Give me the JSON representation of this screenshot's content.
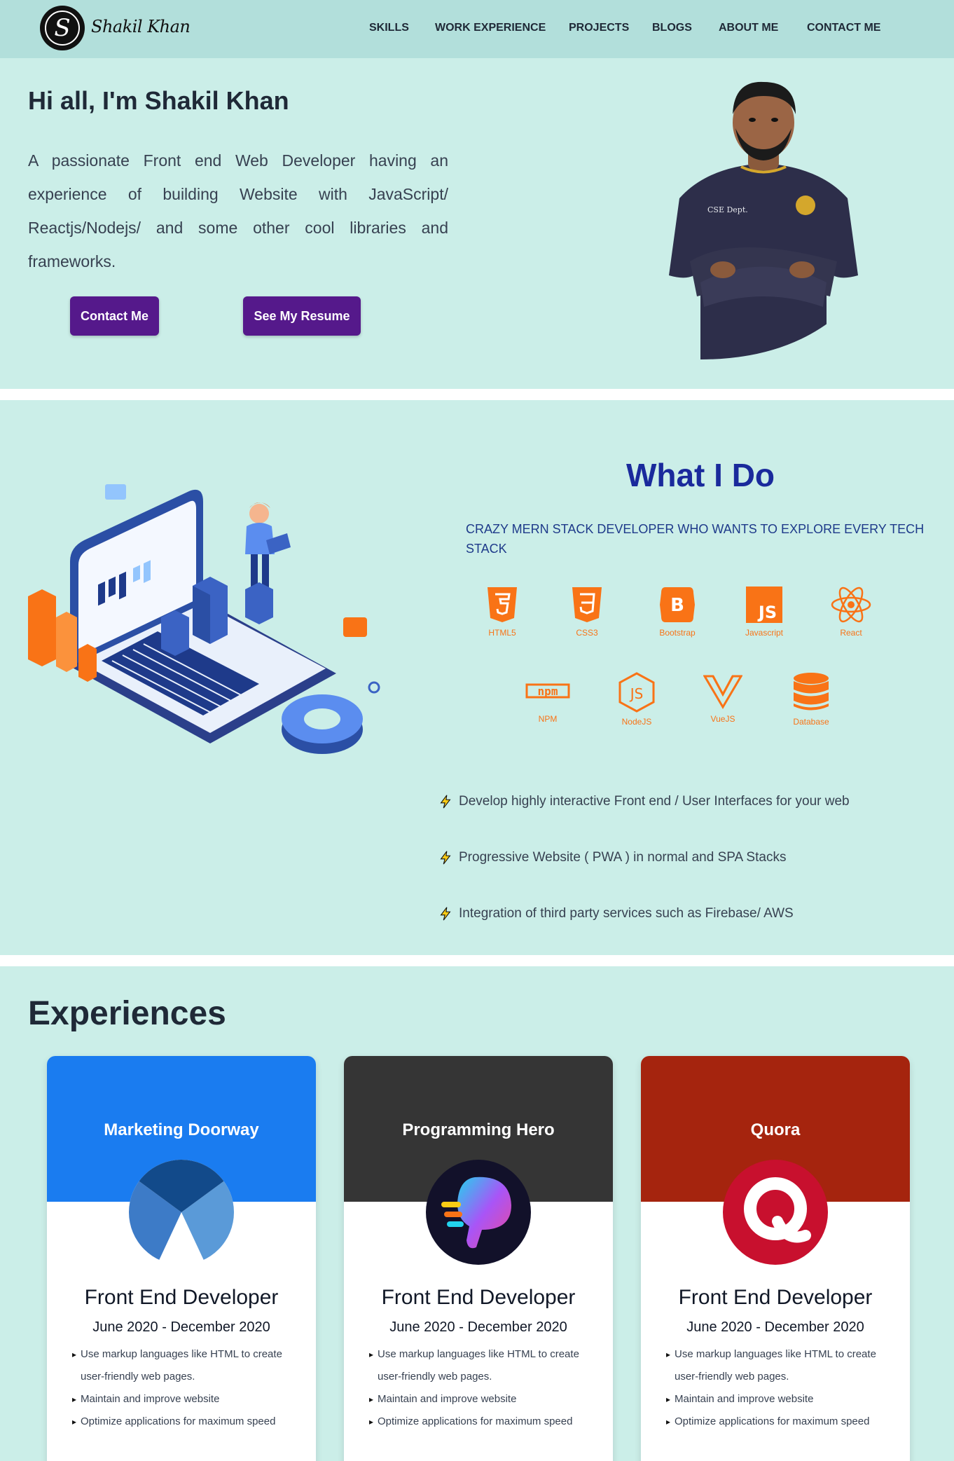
{
  "navbar": {
    "brand_letter": "S",
    "brand_name": "Shakil Khan",
    "links": [
      "SKILLS",
      "WORK EXPERIENCE",
      "PROJECTS",
      "BLOGS",
      "ABOUT ME",
      "CONTACT ME"
    ]
  },
  "hero": {
    "title": "Hi all, I'm Shakil Khan",
    "description": "A passionate Front end Web Developer having an experience of building Website with JavaScript/ Reactjs/Nodejs/ and some other cool libraries and frameworks.",
    "contact_button": "Contact Me",
    "resume_button": "See My Resume"
  },
  "whatido": {
    "title": "What I Do",
    "subtitle": "CRAZY MERN STACK DEVELOPER WHO WANTS TO EXPLORE EVERY TECH STACK",
    "skills": [
      "HTML5",
      "CSS3",
      "Bootstrap",
      "Javascript",
      "React",
      "NPM",
      "NodeJS",
      "VueJS",
      "Database"
    ],
    "points": [
      "Develop highly interactive Front end / User Interfaces for your web",
      "Progressive Website ( PWA ) in normal and SPA Stacks",
      "Integration of third party services such as Firebase/ AWS"
    ]
  },
  "experiences": {
    "heading": "Experiences",
    "cards": [
      {
        "company": "Marketing Doorway",
        "role": "Front End Developer",
        "date": "June 2020 - December 2020",
        "banner_color": "#1a7cf0",
        "points": [
          "Use markup languages like HTML to create user-friendly web pages.",
          "Maintain and improve website",
          "Optimize applications for maximum speed"
        ]
      },
      {
        "company": "Programming Hero",
        "role": "Front End Developer",
        "date": "June 2020 - December 2020",
        "banner_color": "#353535",
        "points": [
          "Use markup languages like HTML to create user-friendly web pages.",
          "Maintain and improve website",
          "Optimize applications for maximum speed"
        ]
      },
      {
        "company": "Quora",
        "role": "Front End Developer",
        "date": "June 2020 - December 2020",
        "banner_color": "#a5240e",
        "points": [
          "Use markup languages like HTML to create user-friendly web pages.",
          "Maintain and improve website",
          "Optimize applications for maximum speed"
        ]
      }
    ]
  }
}
